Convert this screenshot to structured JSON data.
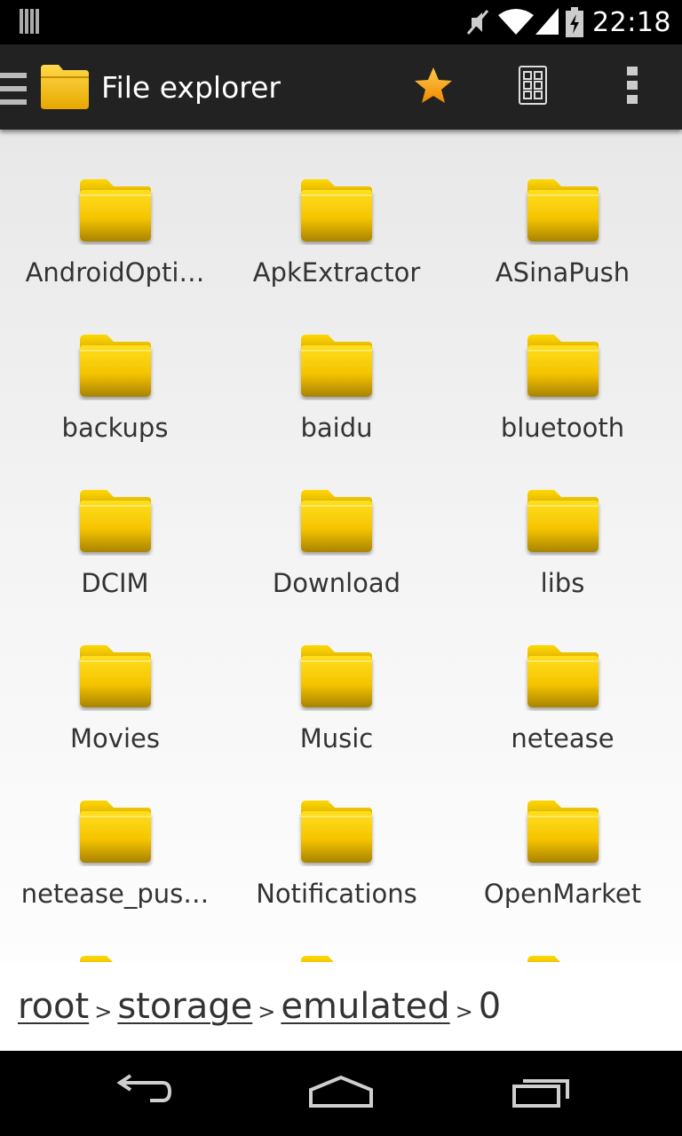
{
  "status_bar": {
    "time": "22:18",
    "icons": [
      "notification-icon",
      "mute-icon",
      "wifi-icon",
      "signal-icon",
      "battery-charging-icon"
    ]
  },
  "action_bar": {
    "title": "File explorer",
    "icons": [
      "drawer-icon",
      "folder-icon",
      "star-icon",
      "grid-view-icon",
      "overflow-menu-icon"
    ],
    "accent": "#f5a623"
  },
  "folders": [
    {
      "name": "AndroidOpti…"
    },
    {
      "name": "ApkExtractor"
    },
    {
      "name": "ASinaPush"
    },
    {
      "name": "backups"
    },
    {
      "name": "baidu"
    },
    {
      "name": "bluetooth"
    },
    {
      "name": "DCIM"
    },
    {
      "name": "Download"
    },
    {
      "name": "libs"
    },
    {
      "name": "Movies"
    },
    {
      "name": "Music"
    },
    {
      "name": "netease"
    },
    {
      "name": "netease_pus…"
    },
    {
      "name": "Notifications"
    },
    {
      "name": "OpenMarket"
    },
    {
      "name": ""
    },
    {
      "name": ""
    },
    {
      "name": ""
    }
  ],
  "breadcrumb": {
    "items": [
      "root",
      "storage",
      "emulated"
    ],
    "separator": ">",
    "current": "0"
  },
  "nav_bar": {
    "icons": [
      "back-icon",
      "home-icon",
      "recent-apps-icon"
    ]
  },
  "colors": {
    "folder_light": "#ffd200",
    "folder_dark": "#b08a00",
    "action_bar_bg": "#222222"
  }
}
